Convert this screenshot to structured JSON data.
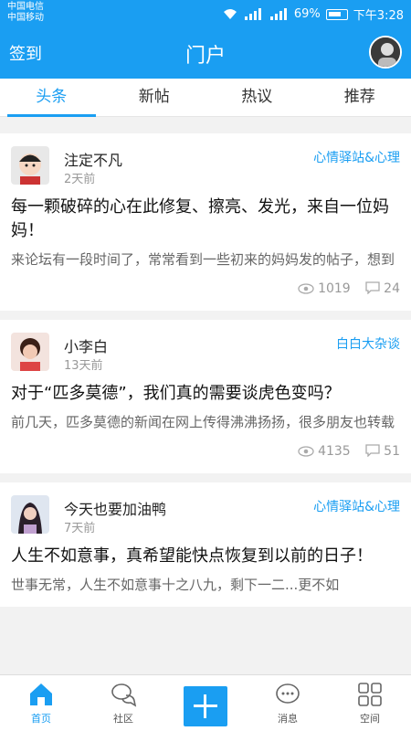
{
  "status_bar": {
    "carrier1": "中国电信",
    "carrier2": "中国移动",
    "network_type": "46 2G",
    "battery": "69%",
    "time": "下午3:28"
  },
  "header": {
    "checkin_label": "签到",
    "title": "门户"
  },
  "tabs": [
    {
      "label": "头条",
      "active": true
    },
    {
      "label": "新帖",
      "active": false
    },
    {
      "label": "热议",
      "active": false
    },
    {
      "label": "推荐",
      "active": false
    }
  ],
  "posts": [
    {
      "author": "注定不凡",
      "time": "2天前",
      "forum": "心情驿站&心理",
      "title": "每一颗破碎的心在此修复、擦亮、发光，来自一位妈妈！",
      "excerpt": "来论坛有一段时间了，常常看到一些初来的妈妈发的帖子，想到",
      "views": "1019",
      "replies": "24"
    },
    {
      "author": "小李白",
      "time": "13天前",
      "forum": "白白大杂谈",
      "title": "对于“匹多莫德”，我们真的需要谈虎色变吗？",
      "excerpt": "前几天，匹多莫德的新闻在网上传得沸沸扬扬，很多朋友也转载",
      "views": "4135",
      "replies": "51"
    },
    {
      "author": "今天也要加油鸭",
      "time": "7天前",
      "forum": "心情驿站&心理",
      "title": "人生不如意事，真希望能快点恢复到以前的日子！",
      "excerpt": "世事无常，人生不如意事十之八九，剩下一二...更不如"
    }
  ],
  "bottom_nav": {
    "home": "首页",
    "community": "社区",
    "messages": "消息",
    "space": "空间"
  },
  "colors": {
    "accent": "#1a9ef2"
  }
}
